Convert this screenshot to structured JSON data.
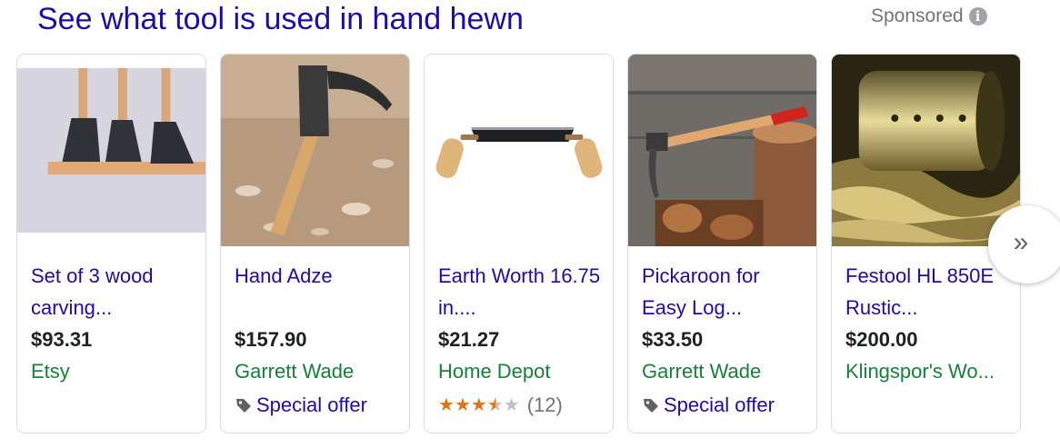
{
  "header": {
    "title": "See what tool is used in hand hewn",
    "sponsored_label": "Sponsored",
    "info_icon": "i"
  },
  "products": [
    {
      "title": "Set of 3 wood carving...",
      "price": "$93.31",
      "store": "Etsy",
      "extra_type": "none",
      "image": "three-carving-axes"
    },
    {
      "title": "Hand Adze",
      "price": "$157.90",
      "store": "Garrett Wade",
      "extra_type": "offer",
      "offer_text": "Special offer",
      "image": "adze-on-wood-chips"
    },
    {
      "title": "Earth Worth 16.75 in....",
      "price": "$21.27",
      "store": "Home Depot",
      "extra_type": "rating",
      "rating": 3.5,
      "rating_max": 5,
      "review_count": "(12)",
      "image": "drawknife"
    },
    {
      "title": "Pickaroon for Easy Log...",
      "price": "$33.50",
      "store": "Garrett Wade",
      "extra_type": "offer",
      "offer_text": "Special offer",
      "image": "pickaroon-on-log"
    },
    {
      "title": "Festool HL 850E Rustic...",
      "price": "$200.00",
      "store": "Klingspor's Wo...",
      "extra_type": "none",
      "image": "planer-drum"
    }
  ],
  "carousel": {
    "next_icon": "»"
  },
  "colors": {
    "link": "#1a0dab",
    "store": "#188038",
    "star": "#e8710a"
  }
}
